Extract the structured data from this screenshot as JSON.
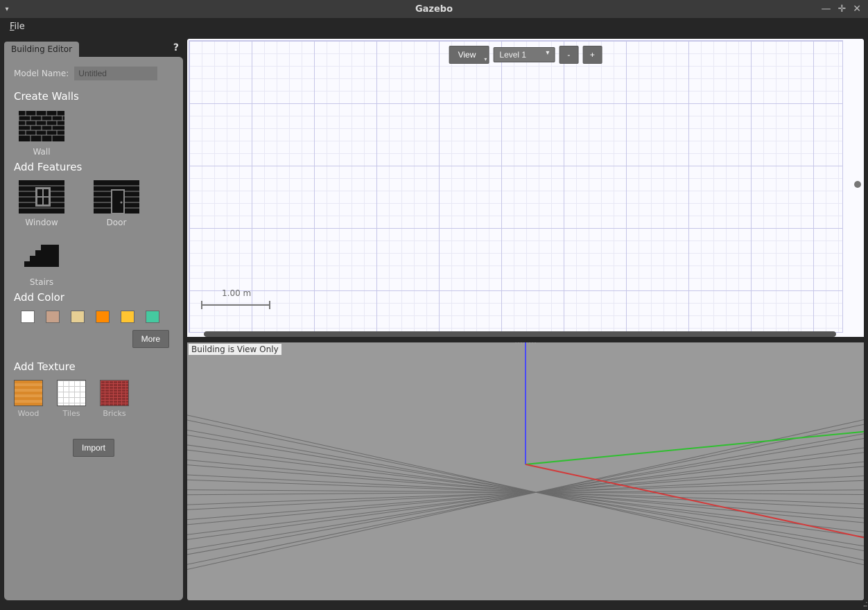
{
  "titlebar": {
    "title": "Gazebo"
  },
  "menubar": {
    "file": "File",
    "file_accel": "F"
  },
  "sidebar": {
    "tab_label": "Building Editor",
    "help_icon": "?",
    "model_name_label": "Model Name:",
    "model_name_value": "Untitled",
    "section_walls": "Create Walls",
    "wall_label": "Wall",
    "section_features": "Add Features",
    "window_label": "Window",
    "door_label": "Door",
    "stairs_label": "Stairs",
    "section_color": "Add Color",
    "colors": [
      "#ffffff",
      "#c7a18a",
      "#e6cf94",
      "#ff8a00",
      "#ffc531",
      "#45c9a0"
    ],
    "more_label": "More",
    "section_texture": "Add Texture",
    "textures": {
      "wood": "Wood",
      "tiles": "Tiles",
      "bricks": "Bricks"
    },
    "import_label": "Import"
  },
  "plan2d": {
    "view_button": "View",
    "level_selected": "Level 1",
    "zoom_out": "-",
    "zoom_in": "+",
    "scale_label": "1.00 m"
  },
  "view3d": {
    "overlay_text": "Building is View Only"
  }
}
